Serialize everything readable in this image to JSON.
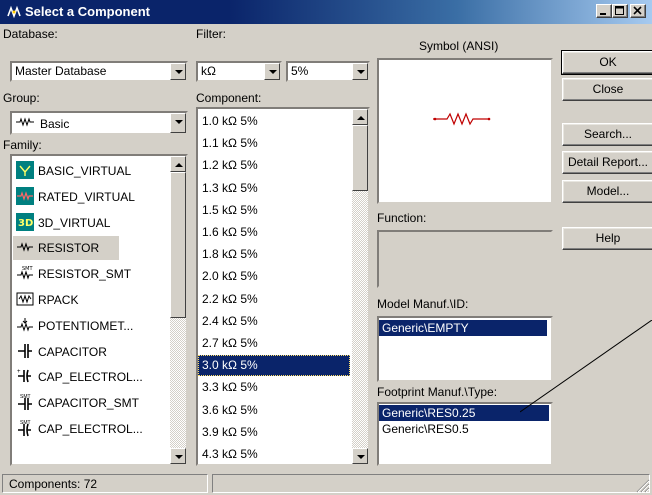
{
  "window": {
    "title": "Select a Component"
  },
  "database": {
    "label": "Database:",
    "value": "Master Database"
  },
  "group": {
    "label": "Group:",
    "value": "Basic"
  },
  "family": {
    "label": "Family:",
    "items": [
      {
        "label": "BASIC_VIRTUAL",
        "icon": "basic-virtual-icon"
      },
      {
        "label": "RATED_VIRTUAL",
        "icon": "rated-virtual-icon"
      },
      {
        "label": "3D_VIRTUAL",
        "icon": "3d-virtual-icon"
      },
      {
        "label": "RESISTOR",
        "icon": "resistor-icon",
        "selected": true
      },
      {
        "label": "RESISTOR_SMT",
        "icon": "resistor-smt-icon"
      },
      {
        "label": "RPACK",
        "icon": "rpack-icon"
      },
      {
        "label": "POTENTIOMET...",
        "icon": "potentiometer-icon"
      },
      {
        "label": "CAPACITOR",
        "icon": "capacitor-icon"
      },
      {
        "label": "CAP_ELECTROL...",
        "icon": "cap-electrolytic-icon"
      },
      {
        "label": "CAPACITOR_SMT",
        "icon": "capacitor-smt-icon"
      },
      {
        "label": "CAP_ELECTROL...",
        "icon": "cap-electrolytic-smt-icon"
      }
    ]
  },
  "filter": {
    "label": "Filter:",
    "unit": "kΩ",
    "tolerance": "5%"
  },
  "component": {
    "label": "Component:",
    "items": [
      "1.0 kΩ 5%",
      "1.1 kΩ 5%",
      "1.2 kΩ 5%",
      "1.3 kΩ 5%",
      "1.5 kΩ 5%",
      "1.6 kΩ 5%",
      "1.8 kΩ 5%",
      "2.0 kΩ 5%",
      "2.2 kΩ 5%",
      "2.4 kΩ 5%",
      "2.7 kΩ 5%",
      "3.0 kΩ 5%",
      "3.3 kΩ 5%",
      "3.6 kΩ 5%",
      "3.9 kΩ 5%",
      "4.3 kΩ 5%"
    ],
    "selected": "3.0 kΩ 5%"
  },
  "symbol": {
    "label": "Symbol (ANSI)"
  },
  "function": {
    "label": "Function:"
  },
  "model": {
    "label": "Model Manuf.\\ID:",
    "items": [
      "Generic\\EMPTY"
    ]
  },
  "footprint": {
    "label": "Footprint Manuf.\\Type:",
    "items": [
      "Generic\\RES0.25",
      "Generic\\RES0.5"
    ]
  },
  "buttons": {
    "ok": "OK",
    "close": "Close",
    "search": "Search...",
    "detail_report": "Detail Report...",
    "model": "Model...",
    "help": "Help"
  },
  "status": {
    "text": "Components: 72"
  },
  "colors": {
    "title_bar": "#0a246a",
    "selection": "#0a246a",
    "face": "#d4d0c8",
    "resistor_symbol": "#c00000"
  }
}
